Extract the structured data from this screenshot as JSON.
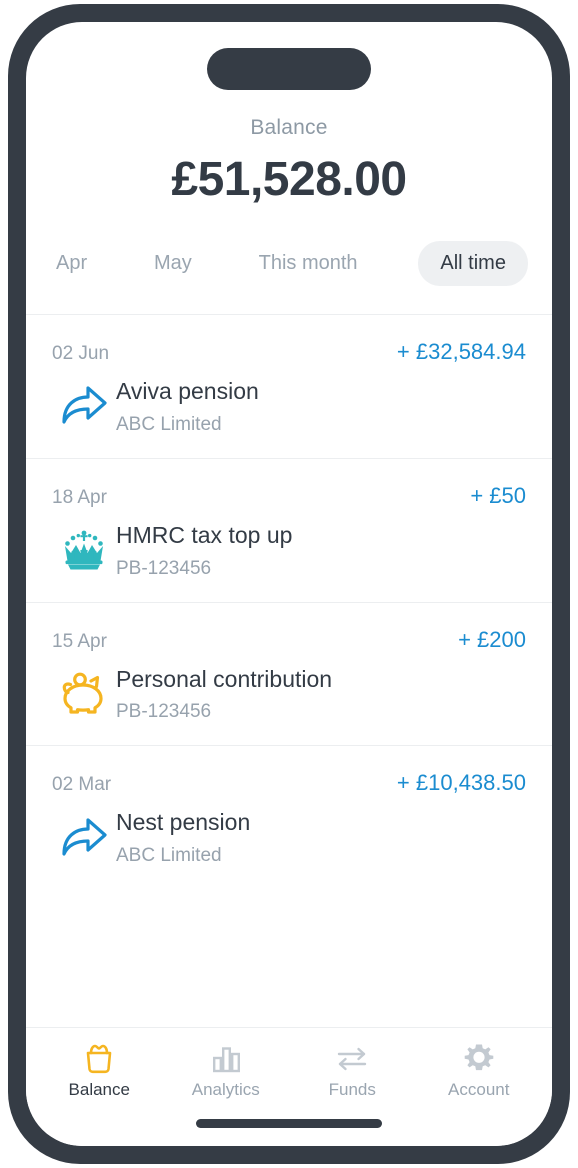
{
  "colors": {
    "frame": "#353c45",
    "accent_blue": "#1b8cd0",
    "accent_amber": "#f5b521",
    "accent_teal": "#2fb7be",
    "text_dark": "#333b45",
    "text_muted": "#97a2ad",
    "pill_bg": "#eef0f2"
  },
  "header": {
    "label": "Balance",
    "amount": "£51,528.00"
  },
  "period_tabs": [
    {
      "label": "Apr",
      "active": false
    },
    {
      "label": "May",
      "active": false
    },
    {
      "label": "This month",
      "active": false
    },
    {
      "label": "All time",
      "active": true
    }
  ],
  "transactions": [
    {
      "date": "02 Jun",
      "amount": "+ £32,584.94",
      "title": "Aviva pension",
      "subtitle": "ABC Limited",
      "icon": "transfer-arrow-icon"
    },
    {
      "date": "18 Apr",
      "amount": "+ £50",
      "title": "HMRC tax top up",
      "subtitle": "PB-123456",
      "icon": "hmrc-crown-icon"
    },
    {
      "date": "15 Apr",
      "amount": "+ £200",
      "title": "Personal contribution",
      "subtitle": "PB-123456",
      "icon": "piggy-bank-icon"
    },
    {
      "date": "02 Mar",
      "amount": "+ £10,438.50",
      "title": "Nest pension",
      "subtitle": "ABC Limited",
      "icon": "transfer-arrow-icon"
    }
  ],
  "tab_bar": [
    {
      "label": "Balance",
      "icon": "money-pot-icon",
      "active": true
    },
    {
      "label": "Analytics",
      "icon": "bar-chart-icon",
      "active": false
    },
    {
      "label": "Funds",
      "icon": "exchange-arrows-icon",
      "active": false
    },
    {
      "label": "Account",
      "icon": "gear-icon",
      "active": false
    }
  ]
}
